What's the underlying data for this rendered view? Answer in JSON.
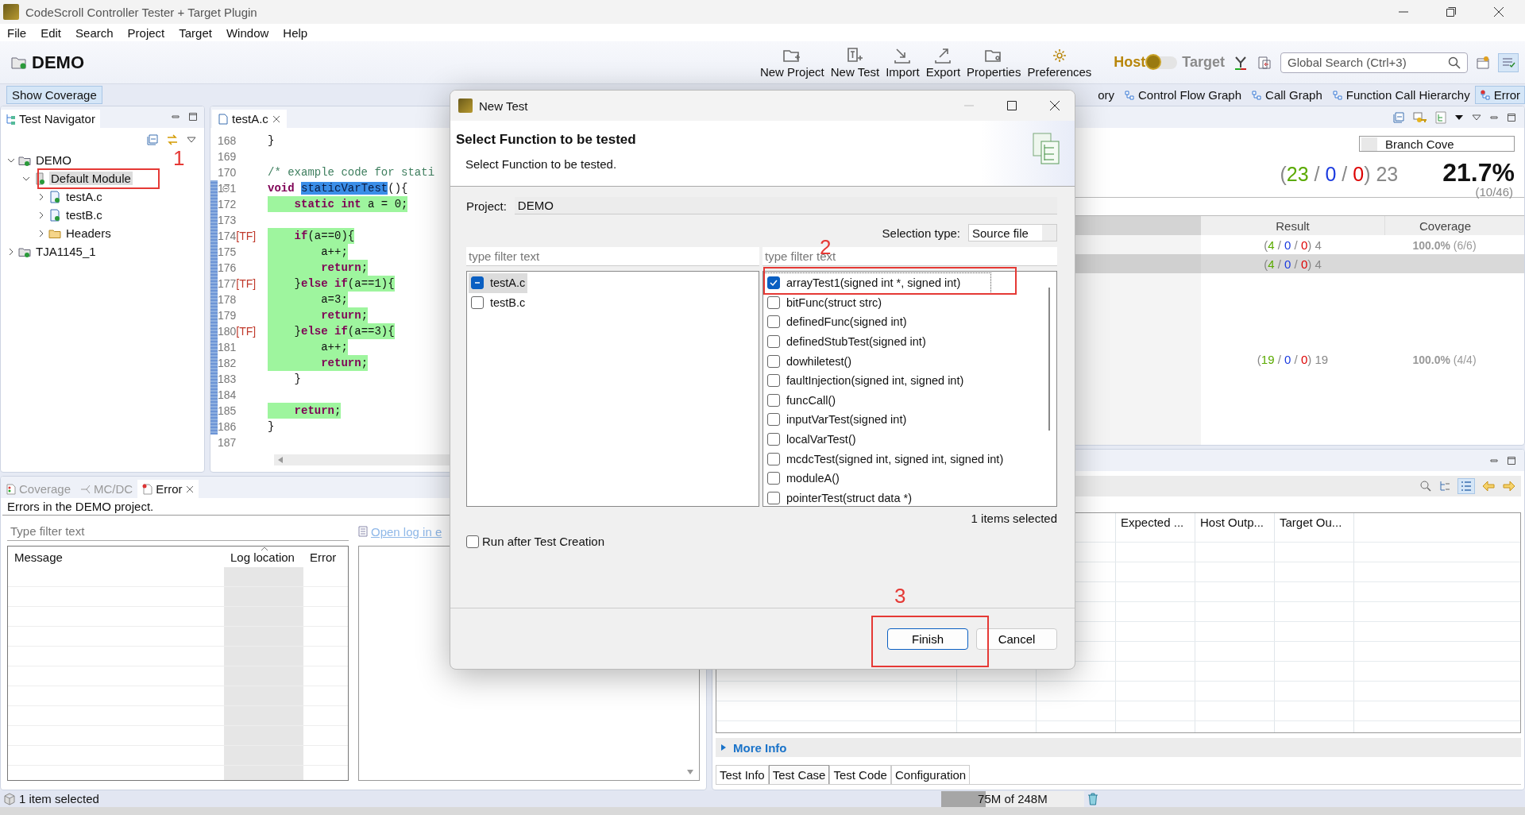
{
  "window": {
    "title": "CodeScroll Controller Tester + Target Plugin"
  },
  "menu": [
    "File",
    "Edit",
    "Search",
    "Project",
    "Target",
    "Window",
    "Help"
  ],
  "toolbar": {
    "project": "DEMO",
    "buttons": [
      {
        "label": "New Project"
      },
      {
        "label": "New Test"
      },
      {
        "label": "Import"
      },
      {
        "label": "Export"
      },
      {
        "label": "Properties"
      },
      {
        "label": "Preferences"
      }
    ],
    "mode": [
      {
        "label": "Host",
        "selected": true
      },
      {
        "label": "Target",
        "selected": false
      }
    ],
    "search": {
      "placeholder": "Global Search (Ctrl+3)"
    }
  },
  "perspective_bar": {
    "left": [
      {
        "label": "Show Coverage",
        "selected": true
      }
    ],
    "right": [
      {
        "label": "ory",
        "selected": false
      },
      {
        "label": "Control Flow Graph",
        "selected": false
      },
      {
        "label": "Call Graph",
        "selected": false
      },
      {
        "label": "Function Call Hierarchy",
        "selected": false
      },
      {
        "label": "Error",
        "selected": true
      }
    ]
  },
  "navigator": {
    "title": "Test Navigator",
    "tree": [
      {
        "label": "DEMO",
        "kind": "project",
        "expanded": true,
        "selected": false,
        "children": [
          {
            "label": "Default Module",
            "kind": "module",
            "expanded": true,
            "selected": true,
            "children": [
              {
                "label": "testA.c",
                "kind": "file",
                "expanded": false,
                "selected": false
              },
              {
                "label": "testB.c",
                "kind": "file",
                "expanded": false,
                "selected": false
              },
              {
                "label": "Headers",
                "kind": "headers",
                "expanded": false,
                "selected": false
              }
            ]
          }
        ]
      },
      {
        "label": "TJA1145_1",
        "kind": "project",
        "expanded": false,
        "selected": false
      }
    ]
  },
  "editor": {
    "tab": "testA.c",
    "lines": [
      {
        "number": "168",
        "range": false,
        "foldable": false,
        "covered": false,
        "segments": [
          {
            "text": "}",
            "kind": "code"
          }
        ]
      },
      {
        "number": "169",
        "range": false,
        "foldable": false,
        "covered": false
      },
      {
        "number": "170",
        "range": false,
        "foldable": false,
        "covered": false,
        "segments": [
          {
            "text": "/* example code for stati",
            "kind": "comment"
          }
        ]
      },
      {
        "number": "171",
        "range": true,
        "foldable": true,
        "covered": false,
        "segments": [
          {
            "text": "void ",
            "kind": "keyword"
          },
          {
            "text": "staticVarTest",
            "kind": "selection"
          },
          {
            "text": "(){",
            "kind": "code"
          }
        ]
      },
      {
        "number": "172",
        "range": true,
        "foldable": false,
        "covered": true,
        "segments": [
          {
            "text": "    static int",
            "kind": "keyword"
          },
          {
            "text": " a = 0;",
            "kind": "code"
          }
        ]
      },
      {
        "number": "173",
        "range": true,
        "foldable": false,
        "covered": false
      },
      {
        "number": "174",
        "marker": "[TF]",
        "range": true,
        "foldable": false,
        "covered": true,
        "segments": [
          {
            "text": "    if",
            "kind": "keyword"
          },
          {
            "text": "(a==0){",
            "kind": "code"
          }
        ]
      },
      {
        "number": "175",
        "range": true,
        "foldable": false,
        "covered": true,
        "segments": [
          {
            "text": "        a++;",
            "kind": "code"
          }
        ]
      },
      {
        "number": "176",
        "range": true,
        "foldable": false,
        "covered": true,
        "segments": [
          {
            "text": "        return",
            "kind": "keyword"
          },
          {
            "text": ";",
            "kind": "code"
          }
        ]
      },
      {
        "number": "177",
        "marker": "[TF]",
        "range": true,
        "foldable": false,
        "covered": true,
        "segments": [
          {
            "text": "    }",
            "kind": "code"
          },
          {
            "text": "else if",
            "kind": "keyword"
          },
          {
            "text": "(a==1){",
            "kind": "code"
          }
        ]
      },
      {
        "number": "178",
        "range": true,
        "foldable": false,
        "covered": true,
        "segments": [
          {
            "text": "        a=3;",
            "kind": "code"
          }
        ]
      },
      {
        "number": "179",
        "range": true,
        "foldable": false,
        "covered": true,
        "segments": [
          {
            "text": "        return",
            "kind": "keyword"
          },
          {
            "text": ";",
            "kind": "code"
          }
        ]
      },
      {
        "number": "180",
        "marker": "[TF]",
        "range": true,
        "foldable": false,
        "covered": true,
        "segments": [
          {
            "text": "    }",
            "kind": "code"
          },
          {
            "text": "else if",
            "kind": "keyword"
          },
          {
            "text": "(a==3){",
            "kind": "code"
          }
        ]
      },
      {
        "number": "181",
        "range": true,
        "foldable": false,
        "covered": true,
        "segments": [
          {
            "text": "        a++;",
            "kind": "code"
          }
        ]
      },
      {
        "number": "182",
        "range": true,
        "foldable": false,
        "covered": true,
        "segments": [
          {
            "text": "        return",
            "kind": "keyword"
          },
          {
            "text": ";",
            "kind": "code"
          }
        ]
      },
      {
        "number": "183",
        "range": true,
        "foldable": false,
        "covered": false,
        "segments": [
          {
            "text": "    }",
            "kind": "code"
          }
        ]
      },
      {
        "number": "184",
        "range": true,
        "foldable": false,
        "covered": false
      },
      {
        "number": "185",
        "range": true,
        "foldable": false,
        "covered": true,
        "segments": [
          {
            "text": "    return",
            "kind": "keyword"
          },
          {
            "text": ";",
            "kind": "code"
          }
        ]
      },
      {
        "number": "186",
        "range": true,
        "foldable": false,
        "covered": false,
        "segments": [
          {
            "text": "}",
            "kind": "code"
          }
        ]
      },
      {
        "number": "187",
        "range": false,
        "foldable": false,
        "covered": false
      }
    ]
  },
  "coverage_view": {
    "metric_select": "Branch Cove",
    "summary": {
      "result": [
        {
          "text": "(",
          "kind": "plain"
        },
        {
          "text": "23",
          "kind": "pass"
        },
        {
          "text": " / ",
          "kind": "plain"
        },
        {
          "text": "0",
          "kind": "fail"
        },
        {
          "text": " / ",
          "kind": "plain"
        },
        {
          "text": "0",
          "kind": "error"
        },
        {
          "text": ") 23",
          "kind": "plain"
        }
      ],
      "percent": "21.7%",
      "ratio": "(10/46)"
    },
    "columns": [
      "Result",
      "Coverage"
    ],
    "rows": [
      {
        "selected": false,
        "result": [
          {
            "text": "(",
            "kind": "plain"
          },
          {
            "text": "4",
            "kind": "pass"
          },
          {
            "text": " / ",
            "kind": "plain"
          },
          {
            "text": "0",
            "kind": "fail"
          },
          {
            "text": " / ",
            "kind": "plain"
          },
          {
            "text": "0",
            "kind": "error"
          },
          {
            "text": ") 4",
            "kind": "plain"
          }
        ],
        "coverage": "**100.0%** (6/6)"
      },
      {
        "selected": true,
        "result": [
          {
            "text": "(",
            "kind": "plain"
          },
          {
            "text": "4",
            "kind": "pass"
          },
          {
            "text": " / ",
            "kind": "plain"
          },
          {
            "text": "0",
            "kind": "fail"
          },
          {
            "text": " / ",
            "kind": "plain"
          },
          {
            "text": "0",
            "kind": "error"
          },
          {
            "text": ") 4",
            "kind": "plain"
          }
        ]
      },
      {
        "selected": false,
        "result": [
          {
            "text": "(",
            "kind": "plain"
          },
          {
            "text": "19",
            "kind": "pass"
          },
          {
            "text": " / ",
            "kind": "plain"
          },
          {
            "text": "0",
            "kind": "fail"
          },
          {
            "text": " / ",
            "kind": "plain"
          },
          {
            "text": "0",
            "kind": "error"
          },
          {
            "text": ") 19",
            "kind": "plain"
          }
        ],
        "coverage": "**100.0%** (4/4)"
      }
    ]
  },
  "error_view": {
    "tabs": [
      {
        "label": "Coverage",
        "selected": false
      },
      {
        "label": "MC/DC",
        "selected": false
      },
      {
        "label": "Error",
        "selected": true
      }
    ],
    "description": "Errors in the DEMO project.",
    "filter": {
      "placeholder": "Type filter text"
    },
    "columns": [
      "Message",
      "Log location",
      "Error"
    ],
    "link": "Open log in e"
  },
  "test_view": {
    "columns": [
      "Expected ...",
      "Host Outp...",
      "Target Ou..."
    ],
    "more_info": "More Info",
    "tabs": [
      {
        "label": "Test Info",
        "selected": false
      },
      {
        "label": "Test Case",
        "selected": true
      },
      {
        "label": "Test Code",
        "selected": false
      },
      {
        "label": "Configuration",
        "selected": false
      }
    ]
  },
  "status_bar": {
    "message": "1 item selected",
    "memory": {
      "text": "75M of 248M",
      "level": 0.31
    }
  },
  "dialog": {
    "title": "New Test",
    "heading": "Select Function to be tested",
    "description": "Select Function to be tested.",
    "project": {
      "label": "Project:",
      "value": "DEMO"
    },
    "selection_type": {
      "label": "Selection type:",
      "value": "Source file"
    },
    "file_filter": {
      "placeholder": "type filter text"
    },
    "function_filter": {
      "placeholder": "type filter text"
    },
    "files": [
      {
        "label": "testA.c",
        "checked": false,
        "partial": true,
        "selected": true
      },
      {
        "label": "testB.c",
        "checked": false,
        "partial": false,
        "selected": false
      }
    ],
    "functions": [
      {
        "label": "arrayTest1(signed int *, signed int)",
        "checked": true,
        "selected": true
      },
      {
        "label": "bitFunc(struct strc)",
        "checked": false,
        "selected": false
      },
      {
        "label": "definedFunc(signed int)",
        "checked": false,
        "selected": false
      },
      {
        "label": "definedStubTest(signed int)",
        "checked": false,
        "selected": false
      },
      {
        "label": "dowhiletest()",
        "checked": false,
        "selected": false
      },
      {
        "label": "faultInjection(signed int, signed int)",
        "checked": false,
        "selected": false
      },
      {
        "label": "funcCall()",
        "checked": false,
        "selected": false
      },
      {
        "label": "inputVarTest(signed int)",
        "checked": false,
        "selected": false
      },
      {
        "label": "localVarTest()",
        "checked": false,
        "selected": false
      },
      {
        "label": "mcdcTest(signed int, signed int, signed int)",
        "checked": false,
        "selected": false
      },
      {
        "label": "moduleA()",
        "checked": false,
        "selected": false
      },
      {
        "label": "pointerTest(struct data *)",
        "checked": false,
        "selected": false
      }
    ],
    "selected_count": "1 items selected",
    "run_after": {
      "label": "Run after Test Creation",
      "checked": false
    },
    "buttons": [
      {
        "label": "Finish",
        "kind": "primary"
      },
      {
        "label": "Cancel",
        "kind": "secondary"
      }
    ]
  },
  "annotations": [
    {
      "label": "1"
    },
    {
      "label": "2"
    },
    {
      "label": "3"
    }
  ]
}
